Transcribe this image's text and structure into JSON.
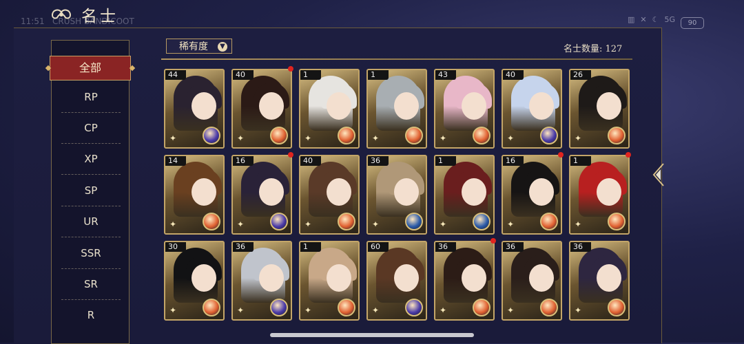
{
  "header": {
    "title": "名士",
    "time_text": "11:51",
    "overlay_text": "CRUSH BANDICOOT",
    "battery": "90",
    "network": "5G"
  },
  "sidebar": {
    "items": [
      {
        "label": "全部",
        "active": true
      },
      {
        "label": "RP"
      },
      {
        "label": "CP"
      },
      {
        "label": "XP"
      },
      {
        "label": "SP"
      },
      {
        "label": "UR"
      },
      {
        "label": "SSR"
      },
      {
        "label": "SR"
      },
      {
        "label": "R"
      }
    ]
  },
  "filter": {
    "label": "稀有度",
    "count_text": "名士数量: 127"
  },
  "cards": [
    {
      "level": "44",
      "hair": "#2a2230",
      "orb": "#4a3aa8",
      "dot": false
    },
    {
      "level": "40",
      "hair": "#2b1a16",
      "orb": "#e06030",
      "dot": true
    },
    {
      "level": "1",
      "hair": "#e6e4e0",
      "orb": "#e06030",
      "dot": false
    },
    {
      "level": "1",
      "hair": "#a8aeb2",
      "orb": "#e06030",
      "dot": false
    },
    {
      "level": "43",
      "hair": "#e8b7c8",
      "orb": "#e06030",
      "dot": false
    },
    {
      "level": "40",
      "hair": "#c6d4ec",
      "orb": "#4a3aa8",
      "dot": false
    },
    {
      "level": "26",
      "hair": "#1e1a18",
      "orb": "#e06030",
      "dot": false
    },
    {
      "level": "14",
      "hair": "#6a4020",
      "orb": "#e06030",
      "dot": false
    },
    {
      "level": "16",
      "hair": "#2a2238",
      "orb": "#4a3aa8",
      "dot": true
    },
    {
      "level": "40",
      "hair": "#5a3a28",
      "orb": "#e06030",
      "dot": false
    },
    {
      "level": "36",
      "hair": "#b09878",
      "orb": "#2a5aa8",
      "dot": false
    },
    {
      "level": "1",
      "hair": "#6a1e1e",
      "orb": "#2a5aa8",
      "dot": false
    },
    {
      "level": "16",
      "hair": "#161414",
      "orb": "#e06030",
      "dot": true
    },
    {
      "level": "1",
      "hair": "#b82020",
      "orb": "#e06030",
      "dot": true
    },
    {
      "level": "30",
      "hair": "#121214",
      "orb": "#e06030",
      "dot": false
    },
    {
      "level": "36",
      "hair": "#c0c4cc",
      "orb": "#4a3aa8",
      "dot": false
    },
    {
      "level": "1",
      "hair": "#c8a888",
      "orb": "#e06030",
      "dot": false
    },
    {
      "level": "60",
      "hair": "#5a3824",
      "orb": "#4a3aa8",
      "dot": false
    },
    {
      "level": "36",
      "hair": "#2c1c16",
      "orb": "#e06030",
      "dot": true
    },
    {
      "level": "36",
      "hair": "#2a1e1a",
      "orb": "#e06030",
      "dot": false
    },
    {
      "level": "36",
      "hair": "#2e2640",
      "orb": "#e06030",
      "dot": false
    }
  ]
}
